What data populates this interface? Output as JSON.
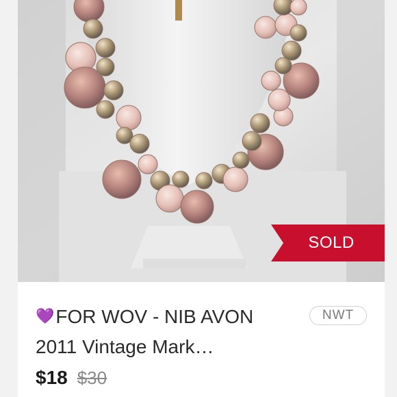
{
  "listing": {
    "title_heart": "💜",
    "title": "FOR WOV - NIB AVON 2011 Vintage Mark…",
    "condition": "NWT",
    "price": "$18",
    "original_price": "$30",
    "status": "SOLD",
    "image_alt": "Pink faceted bead necklace on white display bust"
  },
  "colors": {
    "sold_banner": "#c8102e",
    "price_text": "#1a1a1a",
    "original_price_text": "#8a8a8a",
    "badge_border": "#cfcfcf",
    "heart": "#9b4dff"
  }
}
